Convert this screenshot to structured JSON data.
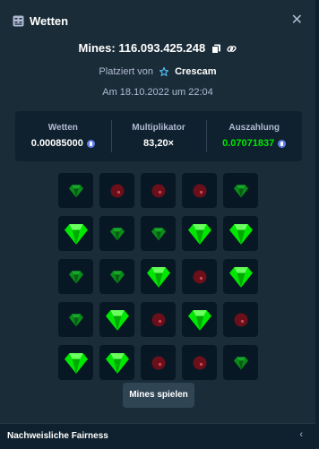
{
  "header": {
    "title": "Wetten",
    "icon": "bet-slip-icon",
    "close_icon": "close-icon",
    "close_glyph": "✕"
  },
  "bet": {
    "id_label": "Mines: 116.093.425.248",
    "placed_by_label": "Platziert von",
    "user": "Crescam",
    "date": "Am 18.10.2022 um 22:04"
  },
  "stats": [
    {
      "label": "Wetten",
      "value": "0.00085000",
      "currency_icon": "eth-icon",
      "highlight": false
    },
    {
      "label": "Multiplikator",
      "value": "83,20×",
      "currency_icon": "",
      "highlight": false
    },
    {
      "label": "Auszahlung",
      "value": "0.07071837",
      "currency_icon": "eth-icon",
      "highlight": true
    }
  ],
  "grid": [
    [
      "gem-dim",
      "mine",
      "mine",
      "mine",
      "gem-dim"
    ],
    [
      "gem",
      "gem-dim",
      "gem-dim",
      "gem",
      "gem"
    ],
    [
      "gem-dim",
      "gem-dim",
      "gem",
      "mine",
      "gem"
    ],
    [
      "gem-dim",
      "gem",
      "mine",
      "gem",
      "mine"
    ],
    [
      "gem",
      "gem",
      "mine",
      "mine",
      "gem-dim"
    ]
  ],
  "button": {
    "label": "Mines spielen"
  },
  "footer": {
    "label": "Nachweisliche Fairness",
    "chevron_glyph": "‹"
  },
  "colors": {
    "gem": "#00e701",
    "mine": "#6b0f1a",
    "accent": "#627eea",
    "background": "#1a2c38"
  }
}
